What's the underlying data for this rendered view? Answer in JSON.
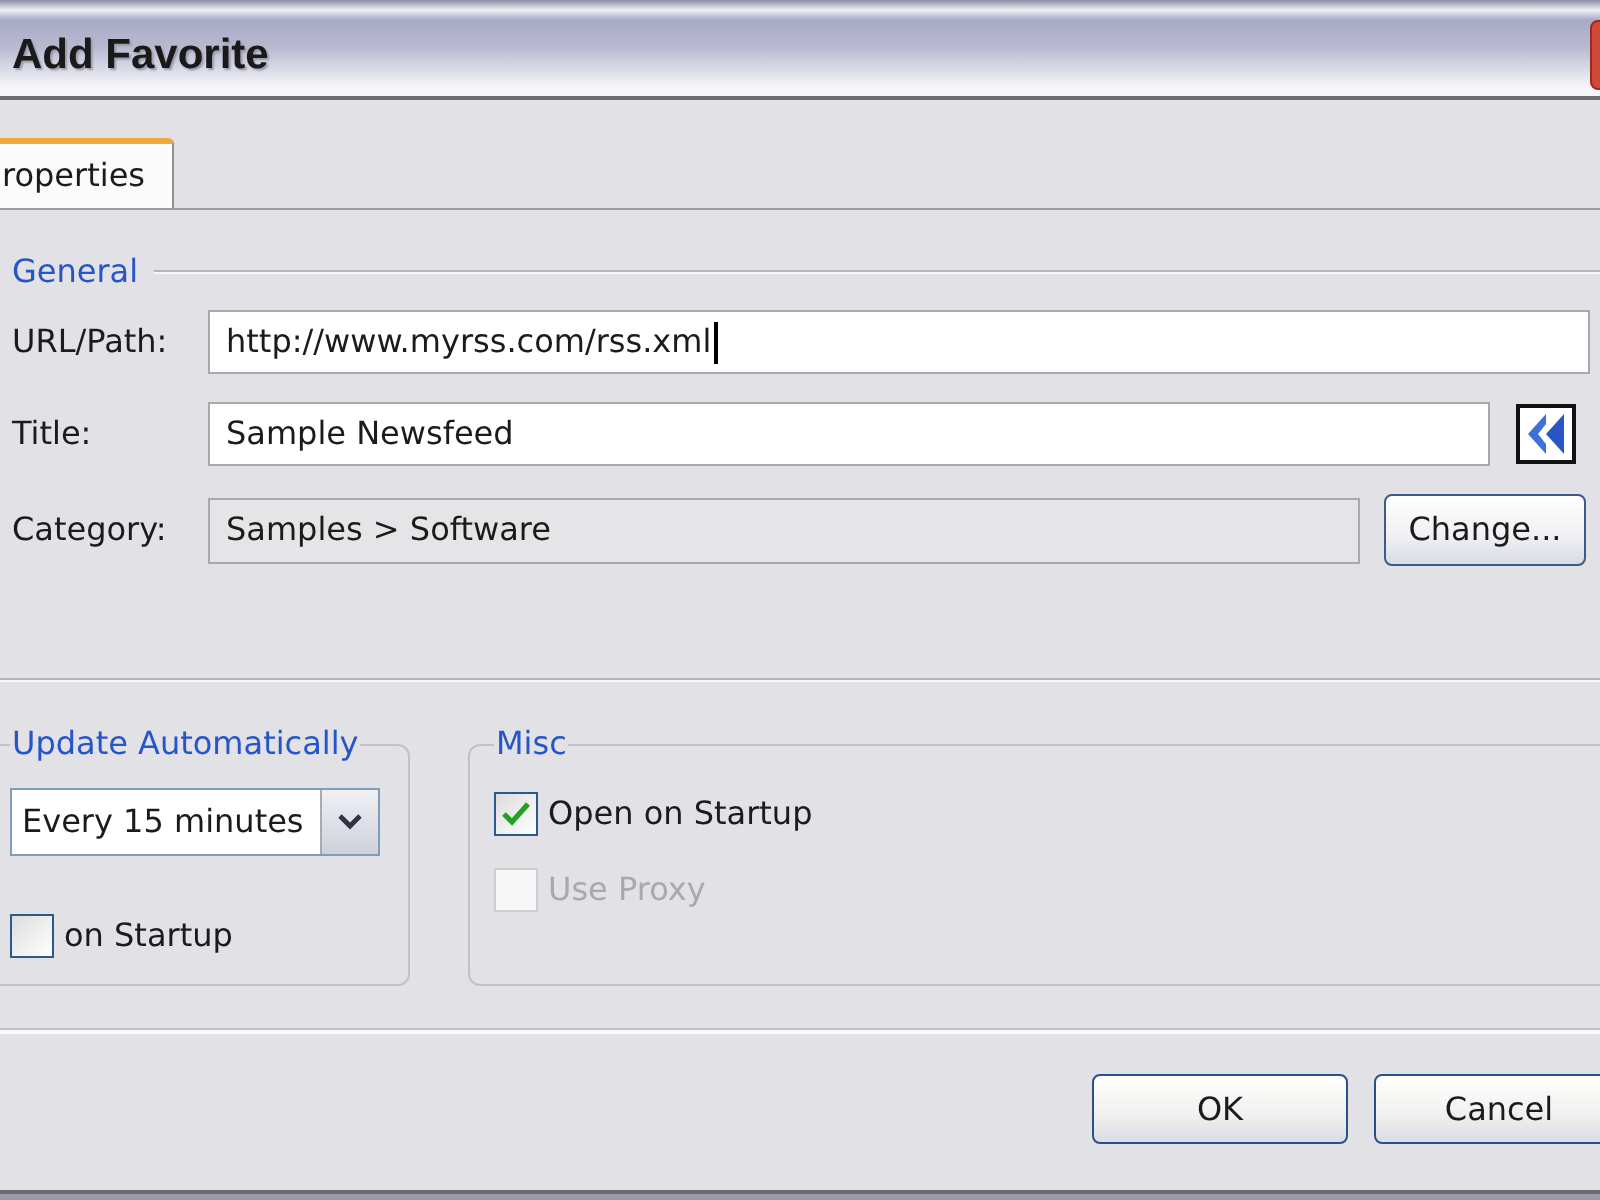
{
  "window": {
    "title": "Add Favorite"
  },
  "tabs": [
    {
      "label": "roperties",
      "selected": true
    }
  ],
  "general": {
    "legend": "General",
    "fields": [
      {
        "kind": "text",
        "label": "URL/Path:",
        "value": "http://www.myrss.com/rss.xml",
        "focused": true
      },
      {
        "kind": "text_with_button",
        "label": "Title:",
        "value": "Sample Newsfeed"
      },
      {
        "kind": "readonly_with_button",
        "label": "Category:",
        "value": "Samples > Software",
        "button": "Change..."
      }
    ]
  },
  "update": {
    "legend": "Update Automatically",
    "interval": "Every 15 minutes",
    "checkbox": {
      "label": "on Startup",
      "checked": false
    }
  },
  "misc": {
    "legend": "Misc",
    "checkboxes": [
      {
        "label": "Open on Startup",
        "checked": true,
        "disabled": false
      },
      {
        "label": "Use Proxy",
        "checked": false,
        "disabled": true
      }
    ]
  },
  "buttons": [
    {
      "label": "OK"
    },
    {
      "label": "Cancel"
    }
  ]
}
